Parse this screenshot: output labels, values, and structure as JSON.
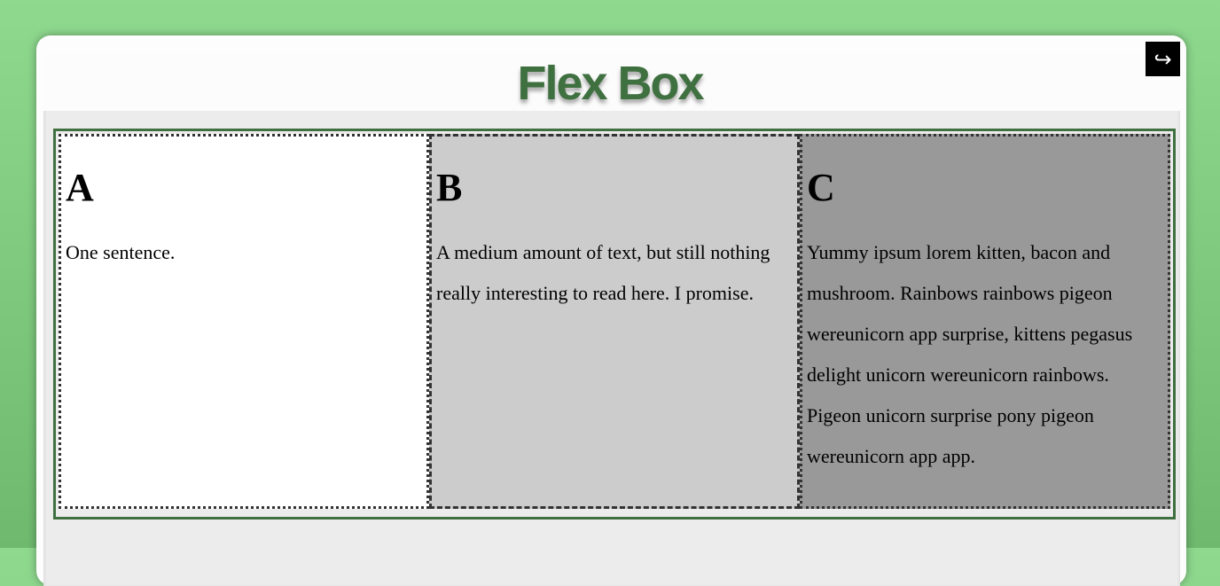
{
  "page": {
    "title": "Flex Box"
  },
  "toolbar": {
    "exit_icon": "↪"
  },
  "boxes": [
    {
      "heading": "A",
      "text": "One sentence."
    },
    {
      "heading": "B",
      "text": "A medium amount of text, but still nothing really interesting to read here. I promise."
    },
    {
      "heading": "C",
      "text": "Yummy ipsum lorem kitten, bacon and mushroom. Rainbows rainbows pigeon wereunicorn app surprise, kittens pegasus delight unicorn wereunicorn rainbows. Pigeon unicorn surprise pony pigeon wereunicorn app app."
    }
  ],
  "colors": {
    "accent": "#3f7040",
    "background": "#8fd98f",
    "box_a": "#ffffff",
    "box_b": "#cccccc",
    "box_c": "#999999"
  }
}
